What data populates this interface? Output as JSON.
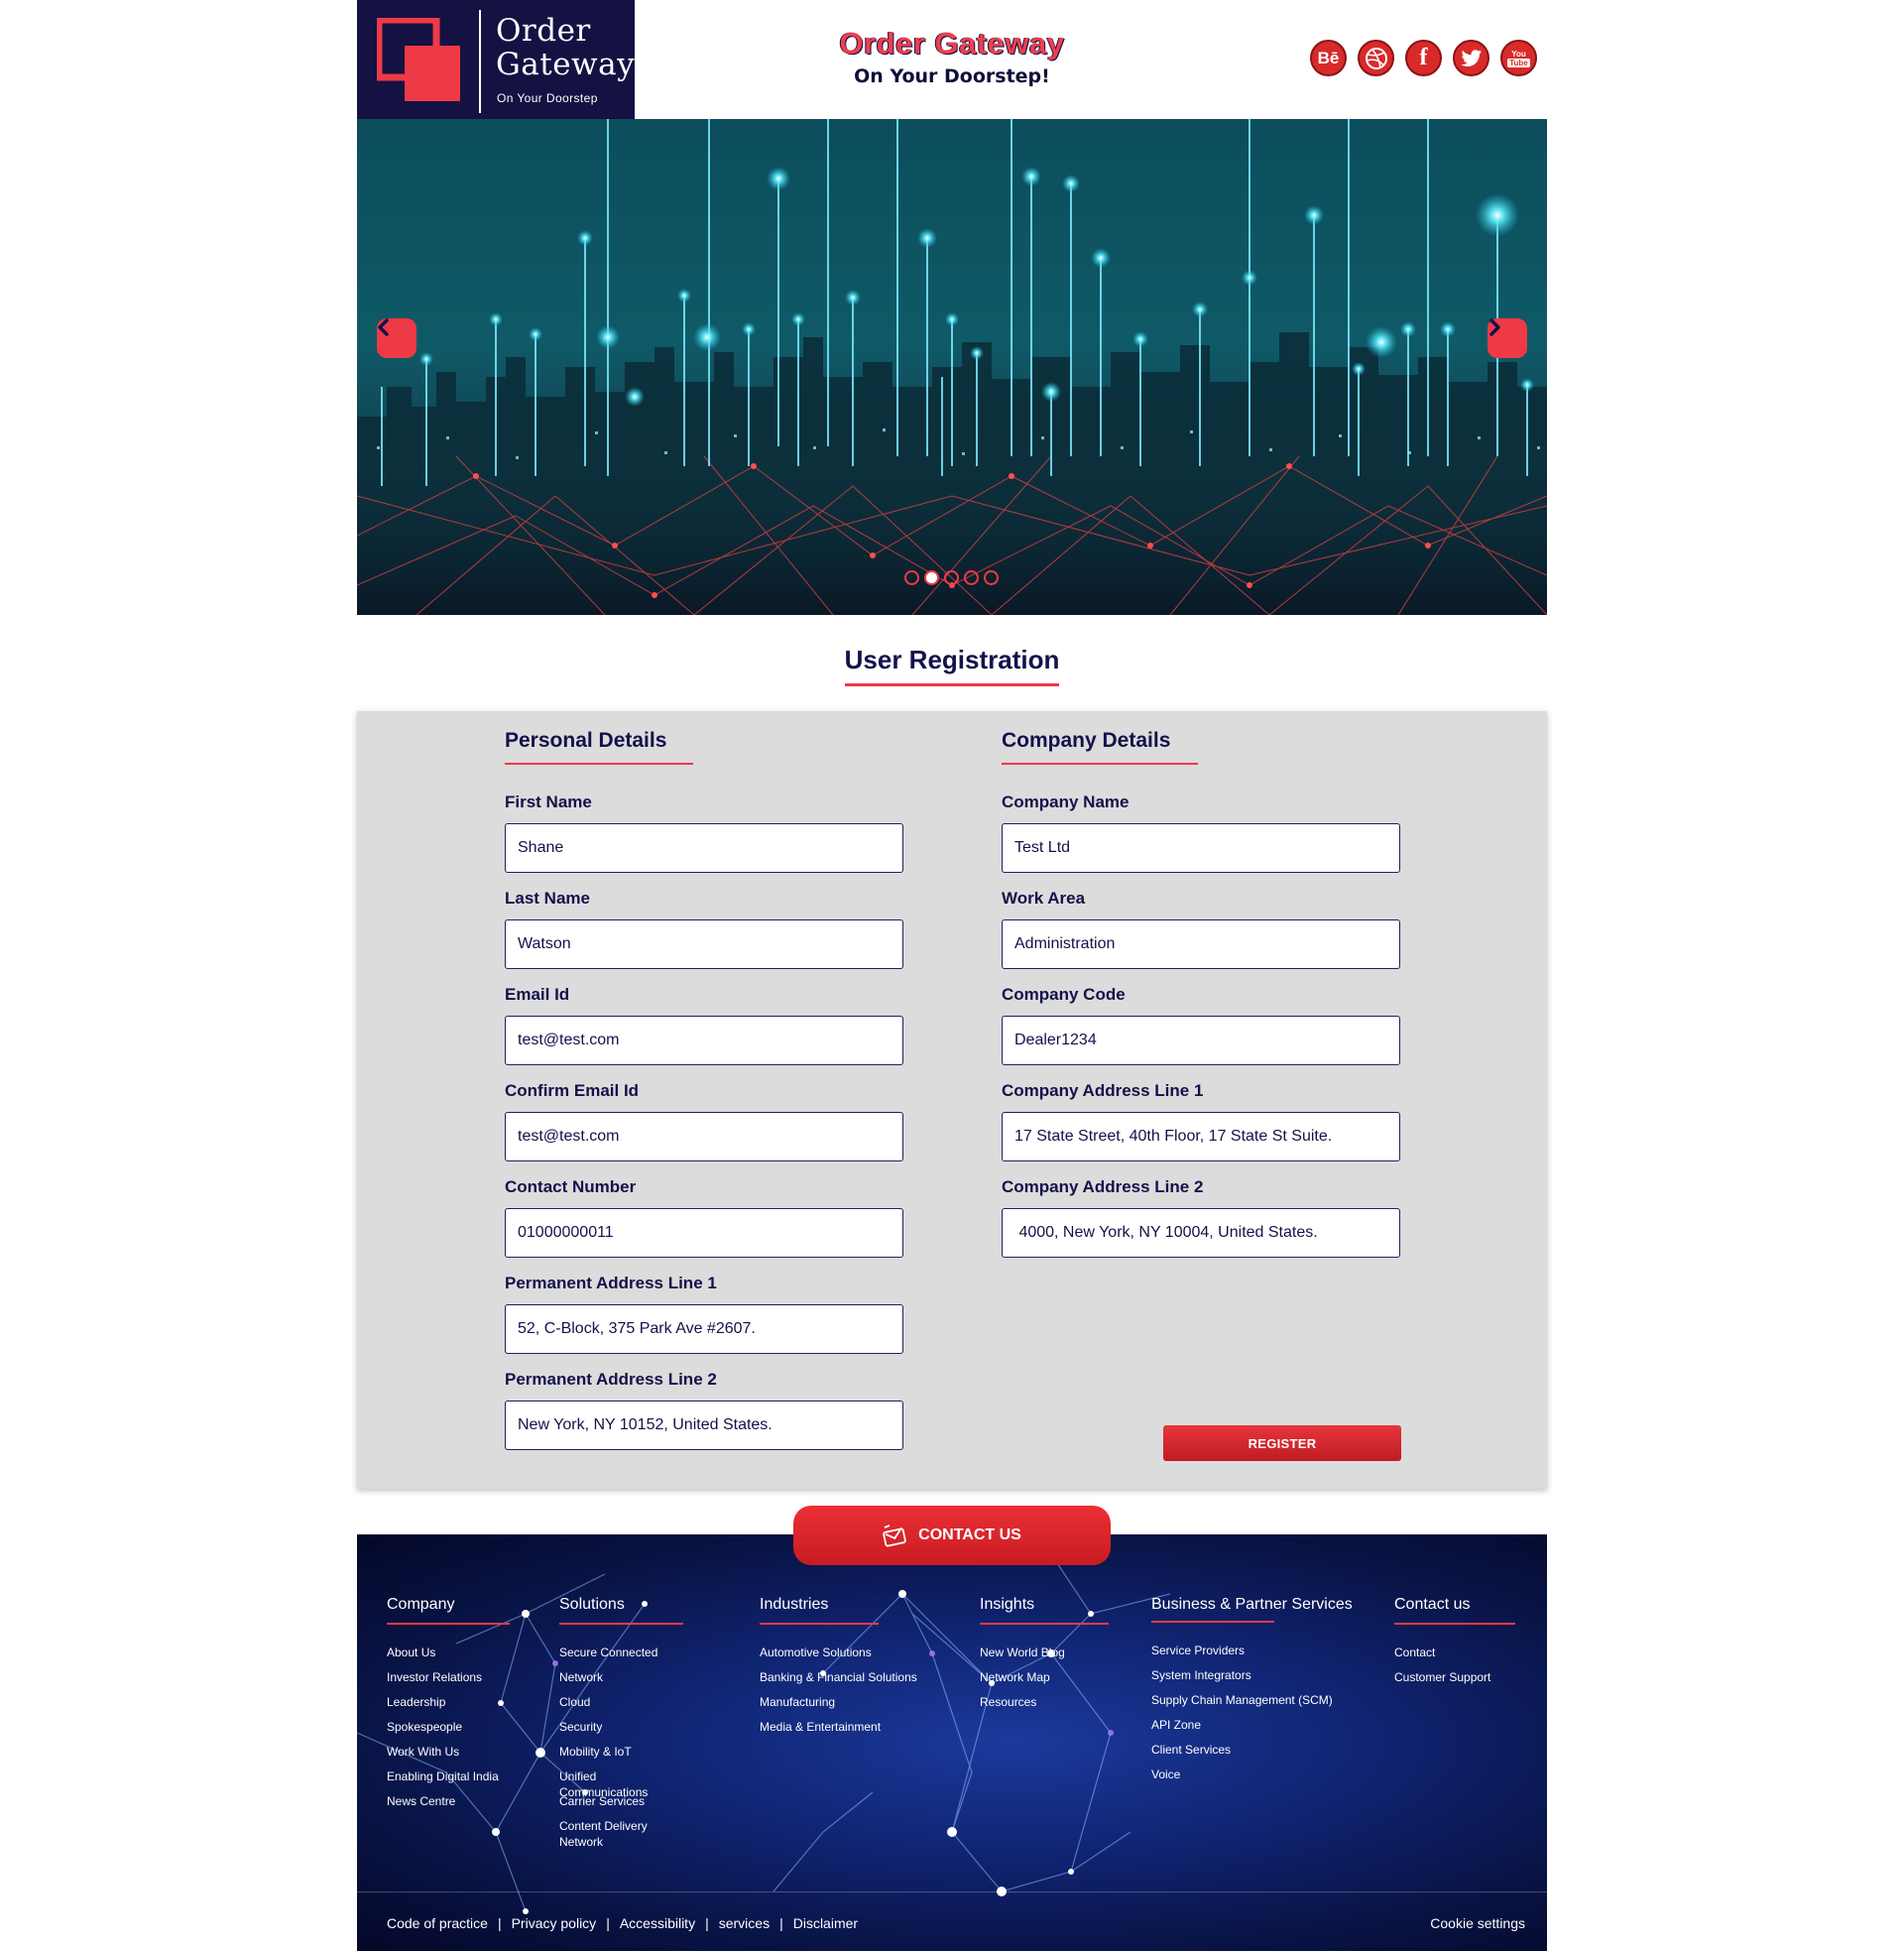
{
  "header": {
    "logo_title": "Order Gateway",
    "logo_tagline": "On Your Doorstep",
    "brand_title": "Order Gateway",
    "brand_tagline": "On Your Doorstep!",
    "social": [
      {
        "name": "behance-icon",
        "glyph": "Bē"
      },
      {
        "name": "dribbble-icon",
        "glyph": "◎"
      },
      {
        "name": "facebook-icon",
        "glyph": "f"
      },
      {
        "name": "twitter-icon",
        "glyph": "🐦"
      },
      {
        "name": "youtube-icon",
        "glyph": "You Tube"
      }
    ]
  },
  "hero": {
    "slides_total": 5,
    "active_slide": 2
  },
  "registration": {
    "title": "User Registration",
    "personal": {
      "heading": "Personal Details",
      "fields": [
        {
          "label": "First Name",
          "value": "Shane"
        },
        {
          "label": "Last Name",
          "value": "Watson"
        },
        {
          "label": "Email Id",
          "value": "test@test.com"
        },
        {
          "label": "Confirm Email Id",
          "value": "test@test.com"
        },
        {
          "label": "Contact Number",
          "value": "01000000011"
        },
        {
          "label": "Permanent Address Line 1",
          "value": "52, C-Block, 375 Park Ave #2607."
        },
        {
          "label": "Permanent Address Line 2",
          "value": "New York, NY 10152, United States."
        }
      ]
    },
    "company": {
      "heading": "Company Details",
      "fields": [
        {
          "label": "Company Name",
          "value": "Test Ltd"
        },
        {
          "label": "Work Area",
          "value": "Administration"
        },
        {
          "label": "Company Code",
          "value": "Dealer1234"
        },
        {
          "label": "Company Address Line 1",
          "value": "17 State Street, 40th Floor, 17 State St Suite."
        },
        {
          "label": "Company Address Line 2",
          "value": " 4000, New York, NY 10004, United States."
        }
      ]
    },
    "register_label": "REGISTER"
  },
  "contact_label": "CONTACT US",
  "footer": {
    "columns": [
      {
        "heading": "Company",
        "items": [
          "About Us",
          "Investor Relations",
          "Leadership",
          "Spokespeople",
          "Work With Us",
          "Enabling Digital India",
          "News Centre"
        ]
      },
      {
        "heading": "Solutions",
        "items": [
          "Secure Connected",
          "Network",
          "Cloud",
          "Security",
          "Mobility & IoT",
          "Unified Communications",
          "Carrier Services",
          "Content Delivery Network"
        ]
      },
      {
        "heading": "Industries",
        "items": [
          "Automotive Solutions",
          "Banking & Financial Solutions",
          "Manufacturing",
          "Media & Entertainment"
        ]
      },
      {
        "heading": "Insights",
        "items": [
          "New World Blog",
          "Network Map",
          "Resources"
        ]
      },
      {
        "heading": "Business & Partner Services",
        "items": [
          "Service Providers",
          "System Integrators",
          "Supply Chain Management (SCM)",
          "API Zone",
          "Client Services",
          "Voice"
        ]
      },
      {
        "heading": "Contact us",
        "items": [
          "Contact",
          "Customer Support"
        ]
      }
    ],
    "legal_links": [
      "Code of practice",
      "Privacy policy",
      "Accessibility",
      "services",
      "Disclaimer"
    ],
    "cookie_label": "Cookie settings"
  },
  "colors": {
    "accent": "#ee3a46",
    "navy": "#14124a",
    "panel": "#dcdcdc"
  }
}
